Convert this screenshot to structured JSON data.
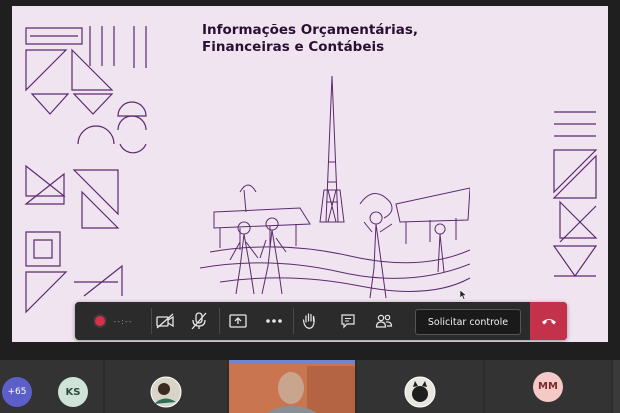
{
  "slide": {
    "title_line1": "Informações Orçamentárias,",
    "title_line2": "Financeiras e Contábeis"
  },
  "toolbar": {
    "timer": "--:--",
    "request_control_label": "Solicitar controle",
    "colors": {
      "record": "#d9304a",
      "hangup": "#c4314b",
      "bar": "#2b2b2b"
    }
  },
  "participants": {
    "more_count": "+65",
    "tiles": [
      {
        "initials": "KS",
        "color": "#cfe3d8"
      },
      {
        "initials": "MM",
        "color": "#f4c9c7"
      }
    ]
  }
}
